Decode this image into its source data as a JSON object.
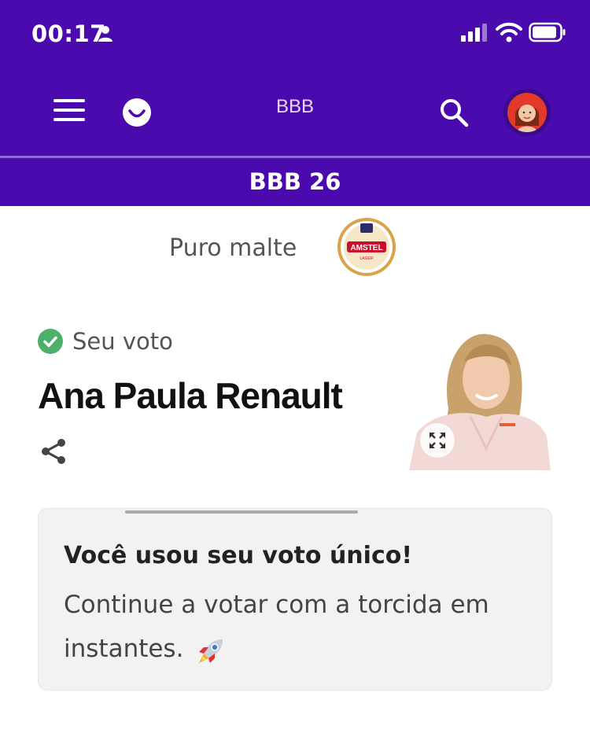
{
  "status_bar": {
    "time": "00:17",
    "person_icon": "person-icon",
    "signal_icon": "cellular-signal-icon",
    "wifi_icon": "wifi-icon",
    "battery_icon": "battery-icon"
  },
  "nav": {
    "menu_icon": "hamburger-menu-icon",
    "logo_icon": "smile-logo-icon",
    "title": "BBB",
    "search_icon": "search-icon",
    "avatar_icon": "avatar-icon"
  },
  "sub_header": {
    "title": "BBB 26"
  },
  "sponsor": {
    "text": "Puro malte",
    "logo_icon": "amstel-logo-icon"
  },
  "vote": {
    "status_icon": "check-circle-icon",
    "label": "Seu voto",
    "candidate": "Ana Paula Renault",
    "share_icon": "share-icon",
    "expand_icon": "expand-icon"
  },
  "notice": {
    "title": "Você usou seu voto único!",
    "body": "Continue a votar com a torcida em instantes.",
    "emoji_icon": "rocket-icon"
  },
  "colors": {
    "brand_purple": "#4a0aad",
    "check_green": "#4caf6a",
    "card_bg": "#f2f2f2"
  }
}
